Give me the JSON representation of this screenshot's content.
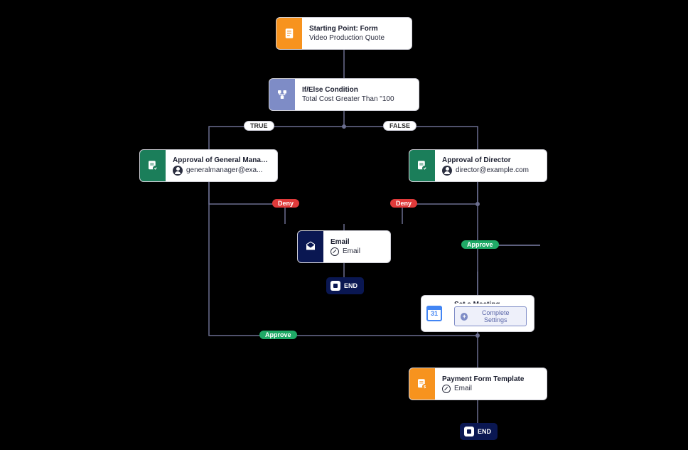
{
  "nodes": {
    "start": {
      "title": "Starting Point: Form",
      "sub": "Video Production Quote"
    },
    "condition": {
      "title": "If/Else Condition",
      "sub": "Total Cost Greater Than \"100"
    },
    "approvalGM": {
      "title": "Approval of General Manager",
      "person": "generalmanager@exa..."
    },
    "approvalDir": {
      "title": "Approval of Director",
      "person": "director@example.com"
    },
    "email": {
      "title": "Email",
      "linkText": "Email"
    },
    "meeting": {
      "title": "Set a Meeting",
      "button": "Complete Settings",
      "calendarDay": "31"
    },
    "payment": {
      "title": "Payment Form Template",
      "linkText": "Email"
    }
  },
  "badges": {
    "true": "TRUE",
    "false": "FALSE",
    "deny": "Deny",
    "approve": "Approve"
  },
  "end": "END"
}
